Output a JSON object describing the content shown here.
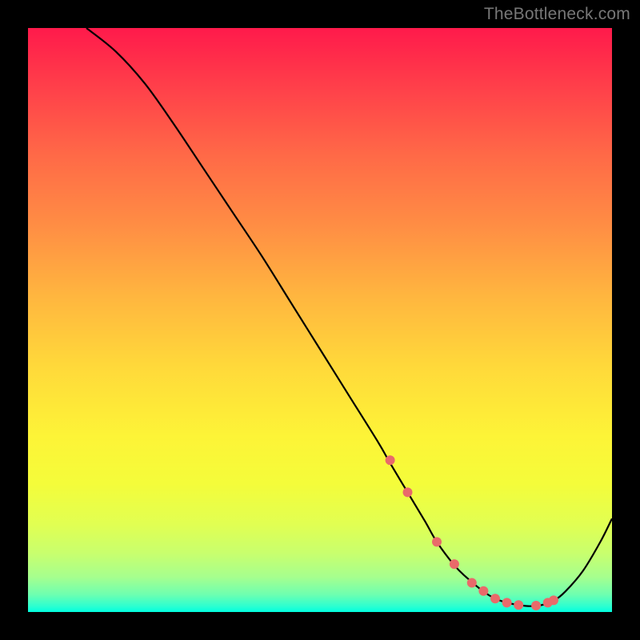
{
  "watermark": "TheBottleneck.com",
  "chart_data": {
    "type": "line",
    "title": "",
    "xlabel": "",
    "ylabel": "",
    "xlim": [
      0,
      100
    ],
    "ylim": [
      0,
      100
    ],
    "grid": false,
    "series": [
      {
        "name": "curve",
        "x": [
          10,
          15,
          20,
          25,
          30,
          35,
          40,
          45,
          50,
          55,
          60,
          62,
          65,
          68,
          70,
          73,
          75,
          78,
          80,
          82,
          84,
          86,
          88,
          90,
          92,
          95,
          98,
          100
        ],
        "values": [
          100,
          96,
          90.5,
          83.5,
          76,
          68.5,
          61,
          53,
          45,
          37,
          29,
          25.5,
          20.5,
          15.5,
          12,
          8,
          6,
          3.5,
          2.3,
          1.6,
          1.2,
          1.0,
          1.2,
          1.9,
          3.5,
          7,
          12,
          16
        ]
      }
    ],
    "markers": {
      "name": "highlight-points",
      "x": [
        62,
        65,
        70,
        73,
        76,
        78,
        80,
        82,
        84,
        87,
        89,
        90
      ],
      "values": [
        26,
        20.5,
        12,
        8.2,
        5.0,
        3.6,
        2.3,
        1.6,
        1.2,
        1.1,
        1.6,
        2.0
      ],
      "color": "#e96a6a",
      "radius": 6
    },
    "background_gradient": {
      "top": "#ff1a4b",
      "mid": "#ffe23a",
      "bottom": "#00ffe0"
    }
  }
}
